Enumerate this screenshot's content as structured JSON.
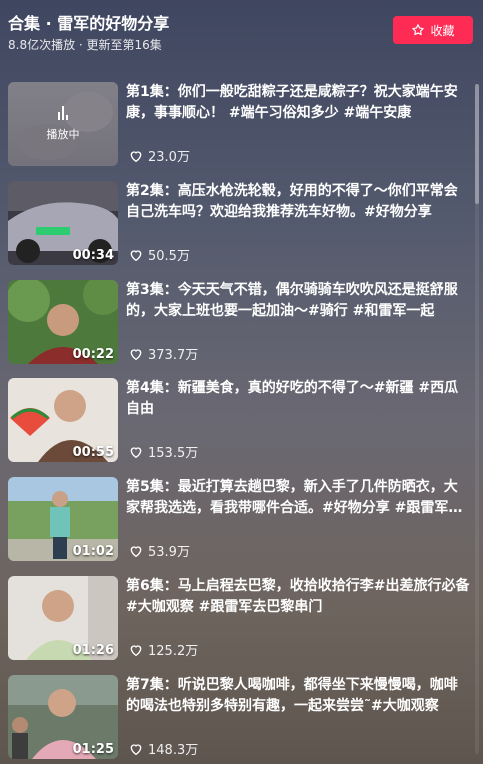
{
  "header": {
    "title": "合集 · 雷军的好物分享",
    "subtitle": "8.8亿次播放 · 更新至第16集",
    "favorite_label": "收藏"
  },
  "episodes": [
    {
      "text": "第1集：你们一般吃甜粽子还是咸粽子？祝大家端午安康，事事顺心！ #端午习俗知多少 #端午安康",
      "likes": "23.0万",
      "duration": "",
      "playing": "播放中"
    },
    {
      "text": "第2集：高压水枪洗轮毂，好用的不得了～你们平常会自己洗车吗？欢迎给我推荐洗车好物。#好物分享",
      "likes": "50.5万",
      "duration": "00:34"
    },
    {
      "text": "第3集：今天天气不错，偶尔骑骑车吹吹风还是挺舒服的，大家上班也要一起加油～#骑行 #和雷军一起",
      "likes": "373.7万",
      "duration": "00:22"
    },
    {
      "text": "第4集：新疆美食，真的好吃的不得了～#新疆 #西瓜自由",
      "likes": "153.5万",
      "duration": "00:55"
    },
    {
      "text": "第5集：最近打算去趟巴黎，新入手了几件防晒衣，大家帮我选选，看我带哪件合适。#好物分享 #跟雷军去巴黎",
      "likes": "53.9万",
      "duration": "01:02"
    },
    {
      "text": "第6集：马上启程去巴黎，收拾收拾行李#出差旅行必备 #大咖观察 #跟雷军去巴黎串门",
      "likes": "125.2万",
      "duration": "01:26"
    },
    {
      "text": "第7集：听说巴黎人喝咖啡，都得坐下来慢慢喝，咖啡的喝法也特别多特别有趣，一起来尝尝˜#大咖观察",
      "likes": "148.3万",
      "duration": "01:25"
    }
  ],
  "colors": {
    "accent": "#fe2c55"
  },
  "icons": {
    "favorite": "star-outline-icon",
    "like": "heart-outline-icon",
    "playing": "audio-bars-icon"
  }
}
